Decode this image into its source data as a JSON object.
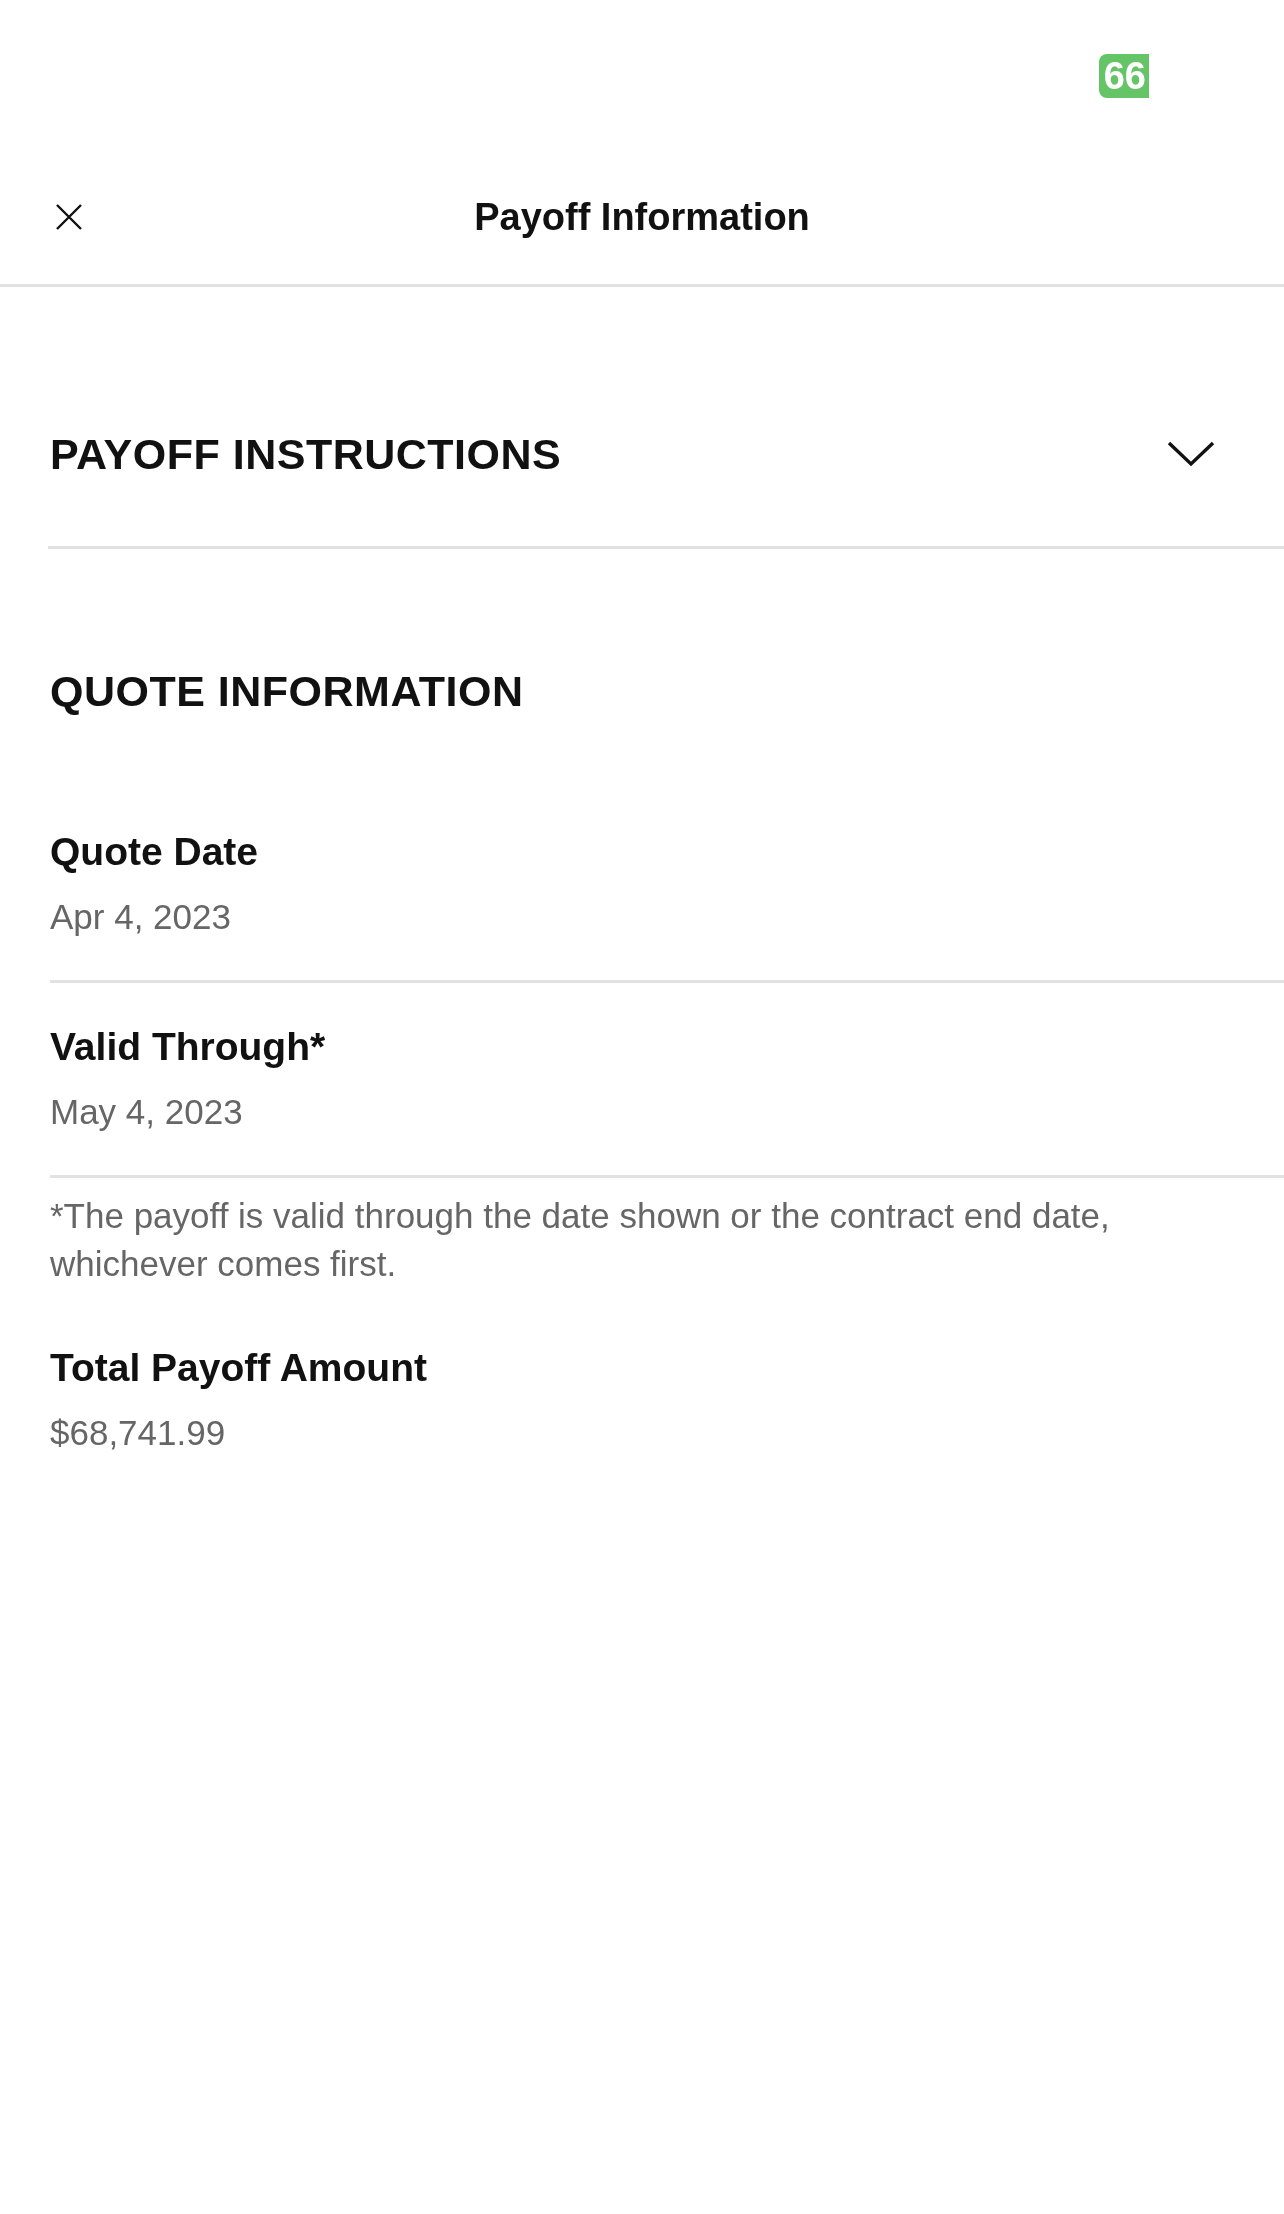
{
  "status_bar": {
    "battery": "66"
  },
  "header": {
    "title": "Payoff Information"
  },
  "sections": [
    {
      "kind": "accordion",
      "title": "PAYOFF INSTRUCTIONS",
      "expanded": false
    },
    {
      "kind": "group",
      "title": "QUOTE INFORMATION",
      "items": [
        {
          "kind": "field",
          "label": "Quote Date",
          "value": "Apr 4, 2023"
        },
        {
          "kind": "field",
          "label": "Valid Through*",
          "value": "May 4, 2023"
        },
        {
          "kind": "note",
          "text": "*The payoff is valid through the date shown or the contract end date, whichever comes first."
        },
        {
          "kind": "field",
          "label": "Total Payoff Amount",
          "value": "$68,741.99"
        }
      ]
    }
  ]
}
